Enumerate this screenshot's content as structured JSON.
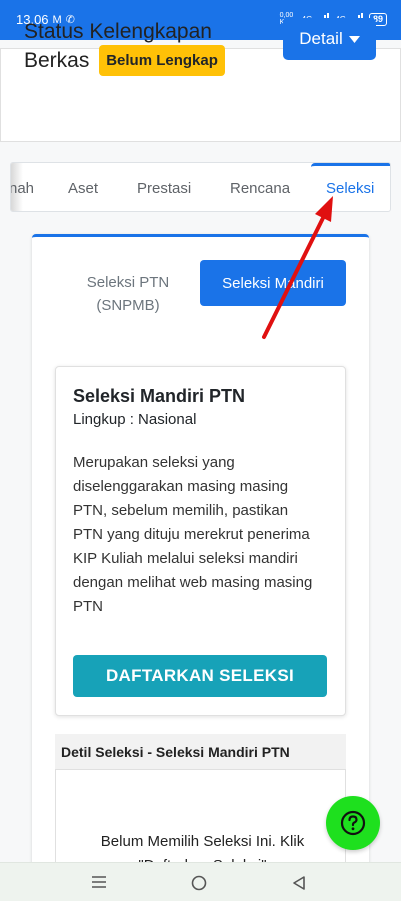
{
  "status_bar": {
    "time": "13.06",
    "data_speed": "0,00 K/S",
    "net1": "4G",
    "net2": "4G",
    "battery": "89"
  },
  "header": {
    "title_line1": "Status Kelengkapan",
    "title_line2": "Berkas",
    "badge": "Belum Lengkap",
    "badge_color": "#ffc107",
    "detail_button": "Detail"
  },
  "tabs": {
    "items": [
      {
        "label": "nah"
      },
      {
        "label": "Aset"
      },
      {
        "label": "Prestasi"
      },
      {
        "label": "Rencana"
      },
      {
        "label": "Seleksi"
      }
    ],
    "active": "Seleksi"
  },
  "selection_toggle": {
    "option1": "Seleksi PTN (SNPMB)",
    "option2": "Seleksi Mandiri",
    "active": "Seleksi Mandiri"
  },
  "info_card": {
    "title": "Seleksi Mandiri PTN",
    "scope": "Lingkup : Nasional",
    "description": "Merupakan seleksi yang diselenggarakan masing masing PTN, sebelum memilih, pastikan PTN yang dituju merekrut penerima KIP Kuliah melalui seleksi mandiri dengan melihat web masing masing PTN",
    "button": "DAFTARKAN SELEKSI"
  },
  "detail_section": {
    "heading": "Detil Seleksi - Seleksi Mandiri PTN",
    "text": "Belum Memilih Seleksi Ini. Klik \"Daftarkan Seleksi\""
  },
  "colors": {
    "primary": "#1a73e8",
    "teal": "#17a2b8",
    "fab": "#1ee01e",
    "annotation_arrow": "#e01010"
  },
  "icons": {
    "help": "question-circle-icon",
    "nav_menu": "menu-icon",
    "nav_home": "home-circle-icon",
    "nav_back": "back-triangle-icon"
  }
}
